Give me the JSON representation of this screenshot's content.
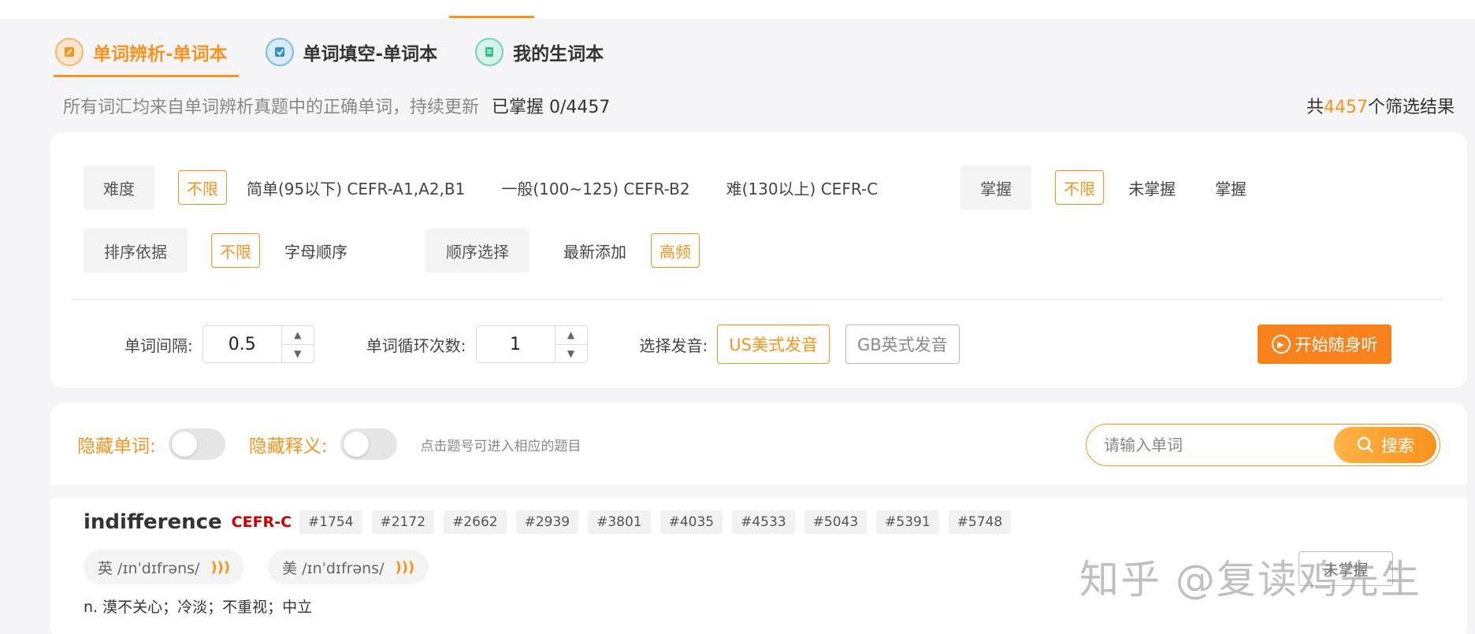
{
  "tabs": [
    {
      "label": "单词辨析-单词本",
      "icon": "word-analysis-icon",
      "active": true
    },
    {
      "label": "单词填空-单词本",
      "icon": "word-fill-icon",
      "active": false
    },
    {
      "label": "我的生词本",
      "icon": "notebook-icon",
      "active": false
    }
  ],
  "subline": {
    "description": "所有词汇均来自单词辨析真题中的正确单词，持续更新",
    "mastered": "已掌握 0/4457"
  },
  "total": {
    "prefix": "共",
    "count": "4457",
    "suffix": "个筛选结果"
  },
  "filters": {
    "difficulty": {
      "label": "难度",
      "options": [
        "不限",
        "简单(95以下) CEFR-A1,A2,B1",
        "一般(100~125) CEFR-B2",
        "难(130以上) CEFR-C"
      ],
      "selected": "不限"
    },
    "mastery": {
      "label": "掌握",
      "options": [
        "不限",
        "未掌握",
        "掌握"
      ],
      "selected": "不限"
    },
    "sort_by": {
      "label": "排序依据",
      "options": [
        "不限",
        "字母顺序"
      ],
      "selected": "不限"
    },
    "order": {
      "label": "顺序选择",
      "options": [
        "最新添加",
        "高频"
      ],
      "selected": "高频"
    }
  },
  "controls": {
    "interval": {
      "label": "单词间隔:",
      "value": "0.5"
    },
    "loops": {
      "label": "单词循环次数:",
      "value": "1"
    },
    "voice": {
      "label": "选择发音:",
      "us": "US美式发音",
      "gb": "GB英式发音",
      "selected": "us"
    },
    "start_label": "开始随身听"
  },
  "list": {
    "hide_word_label": "隐藏单词:",
    "hide_meaning_label": "隐藏释义:",
    "hint": "点击题号可进入相应的题目",
    "search_placeholder": "请输入单词",
    "search_label": "搜索"
  },
  "entries": [
    {
      "word": "indifference",
      "level": "CEFR-C",
      "tags": [
        "#1754",
        "#2172",
        "#2662",
        "#2939",
        "#3801",
        "#4035",
        "#4533",
        "#5043",
        "#5391",
        "#5748"
      ],
      "uk": "英 /ɪnˈdɪfrəns/",
      "us": "美 /ɪnˈdɪfrəns/",
      "meaning": "n. 漠不关心；冷淡；不重视；中立",
      "mark_label": "未掌握"
    }
  ],
  "watermark": "知乎 @复读鸡先生",
  "colors": {
    "accent": "#f7931e",
    "level": "#cc0000"
  }
}
